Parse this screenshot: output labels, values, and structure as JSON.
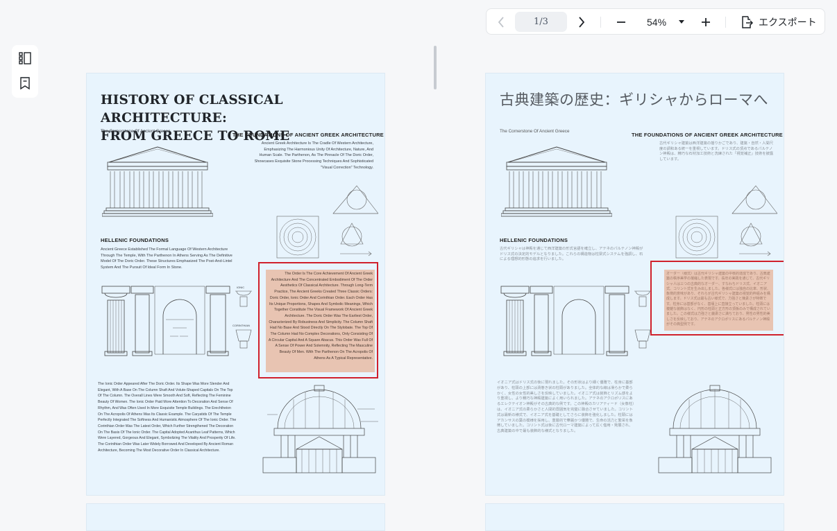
{
  "toolbar": {
    "page_indicator": "1/3",
    "zoom_level": "54%",
    "export_label": "エクスポート"
  },
  "sidebar": {
    "items": [
      {
        "icon": "thumbnails-icon"
      },
      {
        "icon": "bookmark-icon"
      }
    ]
  },
  "page_en": {
    "title_line1": "HISTORY OF CLASSICAL  ARCHITECTURE:",
    "title_line2": "FROM GREECE TO ROME",
    "subtitle": "The Cornerstone Of Ancient Greece",
    "foundations_heading": "THE FOUNDATIONS OF ANCIENT GREEK ARCHITECTURE",
    "foundations_text": "Ancient Greek Architecture Is The Cradle Of Western Architecture, Emphasizing The Harmonious Unity Of Architecture, Nature, And Human Scale. The Parthenon, As The Pinnacle Of The Doric Order, Showcases Exquisite Stone Processing Techniques And Sophisticated \"Visual Correction\" Technology.",
    "hellenic_heading": "HELLENIC FOUNDATIONS",
    "hellenic_text": "Ancient Greece Established The Formal Language Of Western Architecture Through The Temple, With The Parthenon In Athens Serving As The Definitive Model Of The Doric Order. These Structures Emphasized The Post-And-Lintel System And The Pursuit Of Ideal Form In Stone.",
    "highlight_text": "The Order Is The Core Achievement Of Ancient Greek Architecture And The Concentrated Embodiment Of The Order Aesthetics Of Classical Architecture. Through Long-Term Practice, The Ancient Greeks Created Three Classic Orders: Doric Order, Ionic Order And Corinthian Order. Each Order Has Its Unique Proportions, Shapes And Symbolic Meanings, Which Together Constitute The Visual Framework Of Ancient Greek Architecture. The Doric Order Was The Earliest Order, Characterized By Robustness And Simplicity. The Column Shaft Had No Base And Stood Directly On The Stylobate. The Top Of The Column Had No Complex Decorations, Only Consisting Of A Circular Capital And A Square Abacus. This Order Was Full Of A Sense Of Power And Solemnity, Reflecting The Masculine Beauty Of Men. With The Parthenon On The Acropolis Of Athens As A Typical Representative.",
    "ionic_text": "The Ionic Order Appeared After The Doric Order. Its Shape Was More Slender And Elegant, With A Base On The Column Shaft And Volute-Shaped Capitals On The Top Of The Column. The Overall Lines Were Smooth And Soft, Reflecting The Feminine Beauty Of Women. The Ionic Order Paid More Attention To Decoration And Sense Of Rhythm, And Was Often Used In More Exquisite Temple Buildings. The Erechtheion On The Acropolis Of Athens Was Its Classic Example. The Caryatids Of The Temple Perfectly Integrated The Softness And Humanistic Atmosphere Of The Ionic Order. The Corinthian Order Was The Latest Order, Which Further Strengthened The Decoration On The Basis Of The Ionic Order. The Capital Adopted Acanthus Leaf Patterns, Which Were Layered, Gorgeous And Elegant, Symbolizing The Vitality And Prosperity Of Life. The Corinthian Order Was Later Widely Borrowed And Developed By Ancient Roman Architecture, Becoming The Most Decorative Order In Classical Architecture.",
    "label_ionic": "IONIC",
    "label_corinthian": "CORINTHIAN"
  },
  "page_jp": {
    "title": "古典建築の歴史：ギリシャからローマへ",
    "subtitle": "The Cornerstone Of Ancient Greece",
    "foundations_heading": "THE FOUNDATIONS OF ANCIENT GREEK ARCHITECTURE",
    "foundations_text": "古代ギリシャ建築は西洋建築の揺りかごであり、建築・自然・人間尺度の調和ある統一を重視しています。ドリス式の頂点であるパルテノン神殿は、精巧な石材加工技術と洗練された「視覚補正」技術を披露しています。",
    "hellenic_heading": "HELLENIC FOUNDATIONS",
    "hellenic_text": "古代ギリシャは神殿を通じて西洋建築の形式言語を確立し、アテネのパルテノン神殿がドリス式の決定的モデルとなりました。これらの構造物は柱梁式システムを強調し、石による理想的形態の追求を行いました。",
    "highlight_text": "オーダー（様式）は古代ギリシャ建築の中核的達成であり、古典建築の秩序美学の凝縮した表現です。長年の実践を通じて、古代ギリシャ人は三つの古典的なオーダー、すなわちドリス式、イオニア式、コリント式を生み出しました。各様式には独自の比率、形状、象徴的意味があり、それらが古代ギリシャ建築の視覚的枠組みを構成します。ドリス式は最も古い様式で、力強さと簡素さが特徴です。柱身には基部がなく、基壇上に直接立っていました。柱頭には複雑な装飾はなく、円形の柱頭と正方形の頂板のみで構成されていました。この様式は力強さと厳粛さに満ちており、男性の男性的美しさを反映しており、アテネのアクロポリスにあるパルテノン神殿がその典型例です。",
    "ionic_text": "イオニア式はドリス式の後に現れました。その形状はより細く優雅で、柱身に基部があり、柱頭の上部には渦巻き状の柱頭がありました。全体的な線は滑らかで柔らかく、女性の女性的美しさを反映していました。イオニア式は装飾とリズム感をより重視し、より精巧な神殿建築によく用いられました。アテネのアクロポリスにあるエレクテイオン神殿がその古典的な例です。この神殿のカリアティード（女像柱）は、イオニア式の柔らかさと人間的雰囲気を完璧に融合させていました。コリント式は最新の様式で、イオニア式を基礎としてさらに装飾を強化しました。柱頭にはアカンサスの葉の模様を採用し、重層的で華麗かつ優雅で、生命の活力と繁栄を象徴していました。コリント式は後に古代ローマ建築によって広く借用・発展され、古典建築の中で最も装飾的な様式となりました。"
  },
  "colors": {
    "page_bg": "#e8f4fd",
    "highlight": "#e8c4b2",
    "annotation_border": "#d0202b"
  }
}
